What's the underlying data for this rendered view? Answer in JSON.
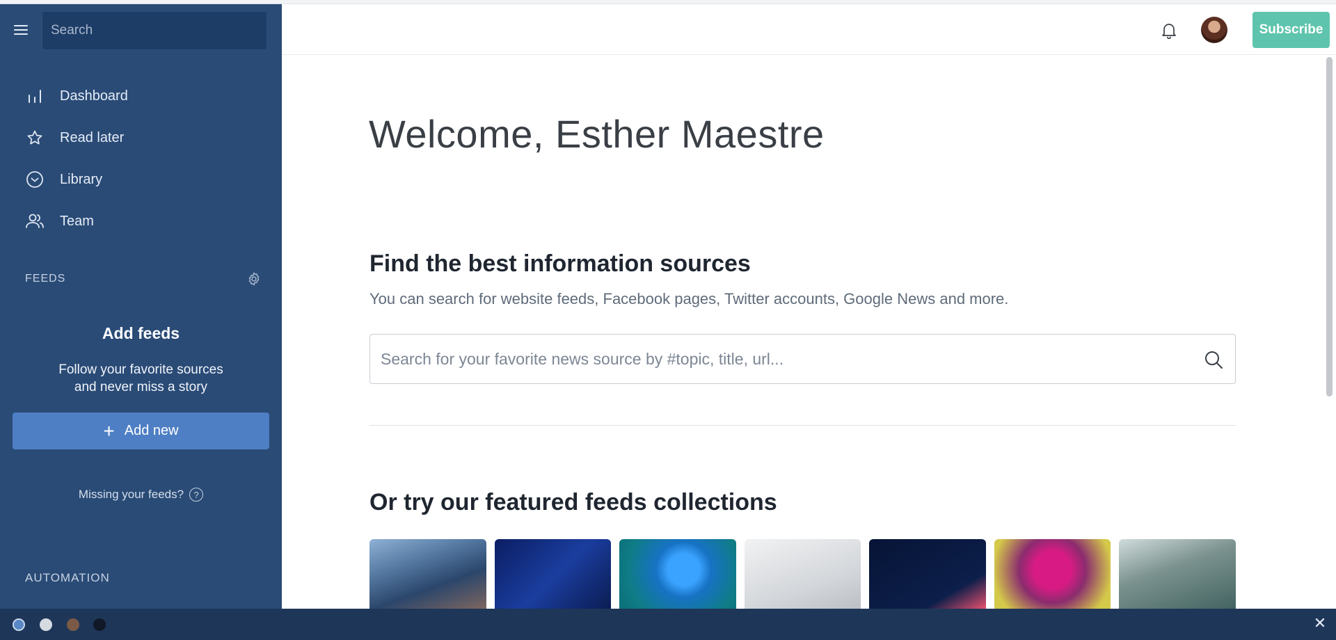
{
  "sidebar": {
    "search_placeholder": "Search",
    "nav": [
      {
        "label": "Dashboard",
        "icon": "bar-chart-icon"
      },
      {
        "label": "Read later",
        "icon": "star-icon"
      },
      {
        "label": "Library",
        "icon": "check-circle-icon"
      },
      {
        "label": "Team",
        "icon": "users-icon"
      }
    ],
    "feeds_heading": "FEEDS",
    "add_feeds_title": "Add feeds",
    "add_feeds_subtitle_1": "Follow your favorite sources",
    "add_feeds_subtitle_2": "and never miss a story",
    "add_new_label": "Add new",
    "missing_feeds": "Missing your feeds?",
    "automation_heading": "AUTOMATION"
  },
  "header": {
    "subscribe_label": "Subscribe"
  },
  "main": {
    "welcome": "Welcome, Esther Maestre",
    "find_title": "Find the best information sources",
    "find_desc": "You can search for website feeds, Facebook pages, Twitter accounts, Google News and more.",
    "search_placeholder": "Search for your favorite news source by #topic, title, url...",
    "collections_title": "Or try our featured feeds collections",
    "collections": [
      "city",
      "data",
      "robot-hand",
      "document",
      "space",
      "colorful",
      "mountains"
    ]
  },
  "bottom_bar": {
    "theme_colors": [
      "#5887c5",
      "#d6dbe2",
      "#7a5a47",
      "#111827"
    ]
  },
  "colors": {
    "sidebar_bg": "#2a4b76",
    "primary": "#4e7fc5",
    "subscribe": "#5ec4ad"
  }
}
